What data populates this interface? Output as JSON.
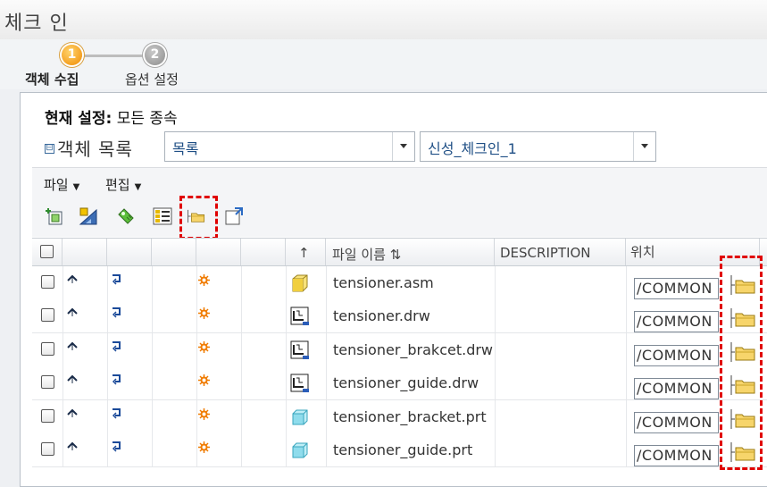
{
  "window": {
    "title": "체크 인"
  },
  "wizard": {
    "steps": [
      {
        "number": "1",
        "label": "객체 수집",
        "active": true
      },
      {
        "number": "2",
        "label": "옵션 설정",
        "active": false
      }
    ]
  },
  "settings": {
    "current_label": "현재 설정:",
    "current_value": "모든 종속"
  },
  "object_list": {
    "collapse_glyph": "⊟",
    "label": "객체 목록",
    "view_select": "목록",
    "config_select": "신성_체크인_1"
  },
  "menu": {
    "file": "파일",
    "edit": "편집",
    "caret": "▼"
  },
  "toolbar": {
    "icons": [
      "add-object-icon",
      "set-location-icon",
      "collect-dependents-icon",
      "grid-columns-icon",
      "set-folder-icon",
      "new-window-icon"
    ]
  },
  "table": {
    "headers": {
      "sort_col": "↑",
      "filename": "파일 이름 ⇅",
      "description": "DESCRIPTION",
      "location": "위치"
    },
    "rows": [
      {
        "filename": "tensioner.asm",
        "location": "/COMMON",
        "type": "asm"
      },
      {
        "filename": "tensioner.drw",
        "location": "/COMMON",
        "type": "drw"
      },
      {
        "filename": "tensioner_brakcet.drw",
        "location": "/COMMON",
        "type": "drw"
      },
      {
        "filename": "tensioner_guide.drw",
        "location": "/COMMON",
        "type": "drw"
      },
      {
        "filename": "tensioner_bracket.prt",
        "location": "/COMMON",
        "type": "prt"
      },
      {
        "filename": "tensioner_guide.prt",
        "location": "/COMMON",
        "type": "prt"
      }
    ]
  },
  "colors": {
    "highlight": "#e00000",
    "step_active": "#f08a00",
    "step_inactive": "#8c8c8c",
    "link_blue": "#1f4f85"
  }
}
